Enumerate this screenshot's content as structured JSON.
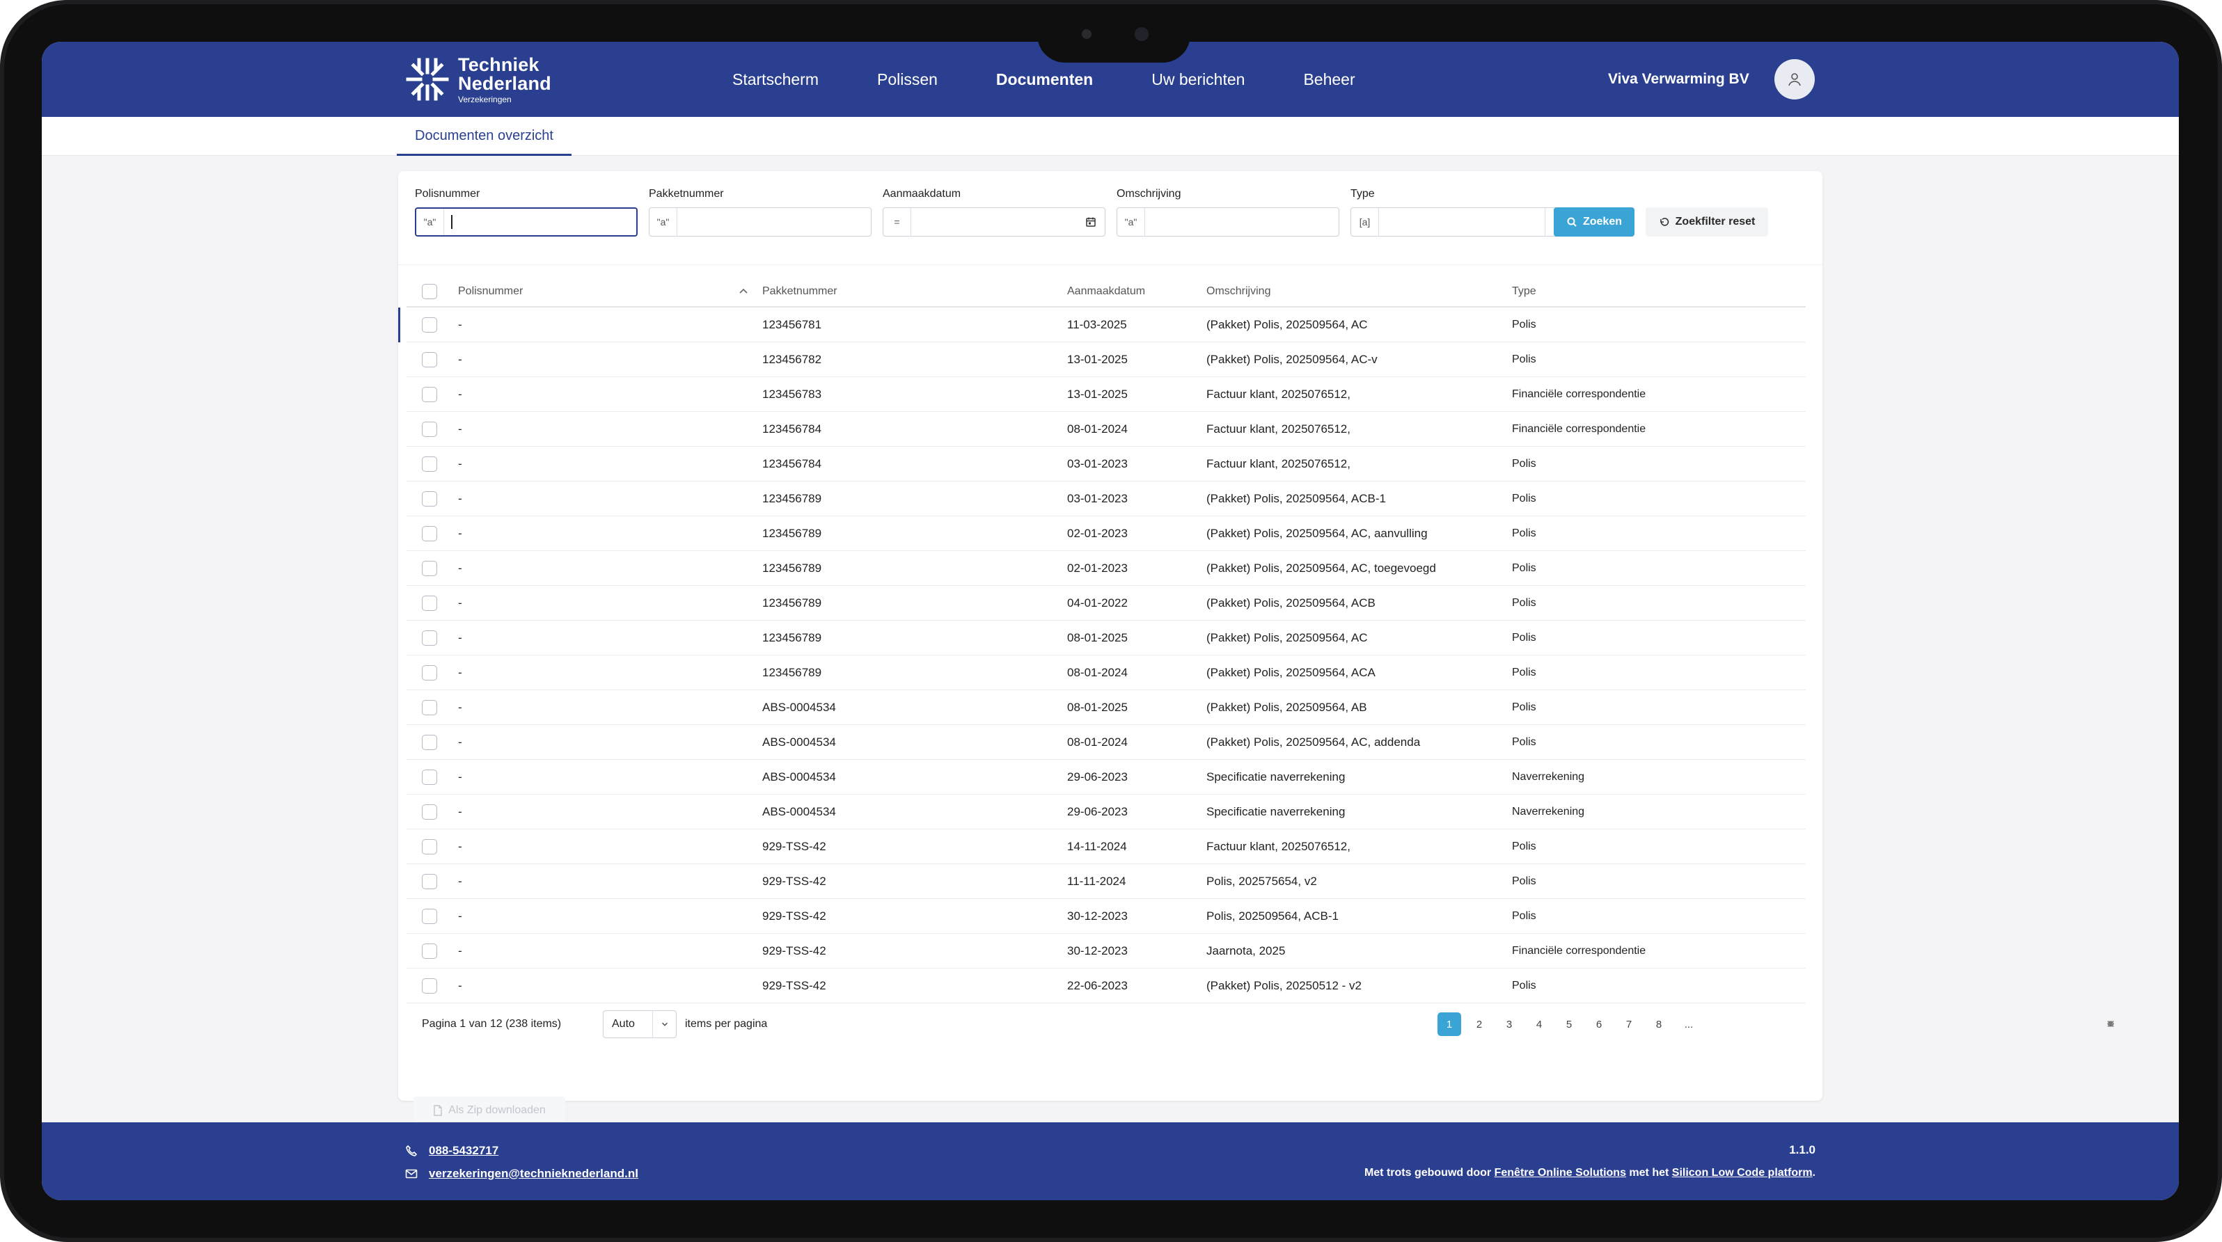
{
  "brand": {
    "name_line1": "Techniek",
    "name_line2": "Nederland",
    "name_line3": "Verzekeringen",
    "primary_color": "#2a3f8f",
    "accent_color": "#3ba4d6"
  },
  "nav": {
    "items": [
      {
        "label": "Startscherm",
        "active": false
      },
      {
        "label": "Polissen",
        "active": false
      },
      {
        "label": "Documenten",
        "active": true
      },
      {
        "label": "Uw berichten",
        "active": false
      },
      {
        "label": "Beheer",
        "active": false
      }
    ],
    "company": "Viva Verwarming BV",
    "avatar_icon": "user-icon"
  },
  "tabs": {
    "active": "Documenten overzicht"
  },
  "filters": {
    "polisnummer": {
      "label": "Polisnummer",
      "op": "\"a\"",
      "value": ""
    },
    "pakketnummer": {
      "label": "Pakketnummer",
      "op": "\"a\"",
      "value": ""
    },
    "aanmaakdatum": {
      "label": "Aanmaakdatum",
      "op": "=",
      "value": ""
    },
    "omschrijving": {
      "label": "Omschrijving",
      "op": "\"a\"",
      "value": ""
    },
    "type": {
      "label": "Type",
      "op": "[a]",
      "value": ""
    },
    "search_label": "Zoeken",
    "reset_label": "Zoekfilter reset"
  },
  "table": {
    "headers": {
      "polisnummer": "Polisnummer",
      "pakketnummer": "Pakketnummer",
      "aanmaakdatum": "Aanmaakdatum",
      "omschrijving": "Omschrijving",
      "type": "Type"
    },
    "rows": [
      {
        "polis": "-",
        "pakket": "123456781",
        "datum": "11-03-2025",
        "oms": "(Pakket) Polis, 202509564, AC",
        "type": "Polis"
      },
      {
        "polis": "-",
        "pakket": "123456782",
        "datum": "13-01-2025",
        "oms": "(Pakket) Polis, 202509564, AC-v",
        "type": "Polis"
      },
      {
        "polis": "-",
        "pakket": "123456783",
        "datum": "13-01-2025",
        "oms": "Factuur klant, 2025076512,",
        "type": "Financiële correspondentie"
      },
      {
        "polis": "-",
        "pakket": "123456784",
        "datum": "08-01-2024",
        "oms": "Factuur klant, 2025076512,",
        "type": "Financiële correspondentie"
      },
      {
        "polis": "-",
        "pakket": "123456784",
        "datum": "03-01-2023",
        "oms": "Factuur klant, 2025076512,",
        "type": "Polis"
      },
      {
        "polis": "-",
        "pakket": "123456789",
        "datum": "03-01-2023",
        "oms": "(Pakket) Polis, 202509564, ACB-1",
        "type": "Polis"
      },
      {
        "polis": "-",
        "pakket": "123456789",
        "datum": "02-01-2023",
        "oms": "(Pakket) Polis, 202509564, AC, aanvulling",
        "type": "Polis"
      },
      {
        "polis": "-",
        "pakket": "123456789",
        "datum": "02-01-2023",
        "oms": "(Pakket) Polis, 202509564, AC, toegevoegd",
        "type": "Polis"
      },
      {
        "polis": "-",
        "pakket": "123456789",
        "datum": "04-01-2022",
        "oms": "(Pakket) Polis, 202509564, ACB",
        "type": "Polis"
      },
      {
        "polis": "-",
        "pakket": "123456789",
        "datum": "08-01-2025",
        "oms": "(Pakket) Polis, 202509564, AC",
        "type": "Polis"
      },
      {
        "polis": "-",
        "pakket": "123456789",
        "datum": "08-01-2024",
        "oms": "(Pakket) Polis, 202509564, ACA",
        "type": "Polis"
      },
      {
        "polis": "-",
        "pakket": "ABS-0004534",
        "datum": "08-01-2025",
        "oms": "(Pakket) Polis, 202509564, AB",
        "type": "Polis"
      },
      {
        "polis": "-",
        "pakket": "ABS-0004534",
        "datum": "08-01-2024",
        "oms": "(Pakket) Polis, 202509564, AC, addenda",
        "type": "Polis"
      },
      {
        "polis": "-",
        "pakket": "ABS-0004534",
        "datum": "29-06-2023",
        "oms": "Specificatie naverrekening",
        "type": "Naverrekening"
      },
      {
        "polis": "-",
        "pakket": "ABS-0004534",
        "datum": "29-06-2023",
        "oms": "Specificatie naverrekening",
        "type": "Naverrekening"
      },
      {
        "polis": "-",
        "pakket": "929-TSS-42",
        "datum": "14-11-2024",
        "oms": "Factuur klant, 2025076512,",
        "type": "Polis"
      },
      {
        "polis": "-",
        "pakket": "929-TSS-42",
        "datum": "11-11-2024",
        "oms": "Polis, 202575654, v2",
        "type": "Polis"
      },
      {
        "polis": "-",
        "pakket": "929-TSS-42",
        "datum": "30-12-2023",
        "oms": "Polis, 202509564, ACB-1",
        "type": "Polis"
      },
      {
        "polis": "-",
        "pakket": "929-TSS-42",
        "datum": "30-12-2023",
        "oms": "Jaarnota, 2025",
        "type": "Financiële correspondentie"
      },
      {
        "polis": "-",
        "pakket": "929-TSS-42",
        "datum": "22-06-2023",
        "oms": "(Pakket) Polis, 20250512 - v2",
        "type": "Polis"
      }
    ]
  },
  "pager": {
    "info": "Pagina 1 van 12 (238 items)",
    "page_size": "Auto",
    "page_size_label": "items per pagina",
    "pages": [
      "1",
      "2",
      "3",
      "4",
      "5",
      "6",
      "7",
      "8",
      "..."
    ],
    "current": "1"
  },
  "actions": {
    "zip_label": "Als Zip downloaden"
  },
  "footer": {
    "phone": "088-5432717",
    "email": "verzekeringen@technieknederland.nl",
    "version": "1.1.0",
    "credit_prefix": "Met trots gebouwd door ",
    "credit_link1": "Fenêtre Online Solutions",
    "credit_mid": " met het ",
    "credit_link2": "Silicon Low Code platform",
    "credit_suffix": "."
  }
}
